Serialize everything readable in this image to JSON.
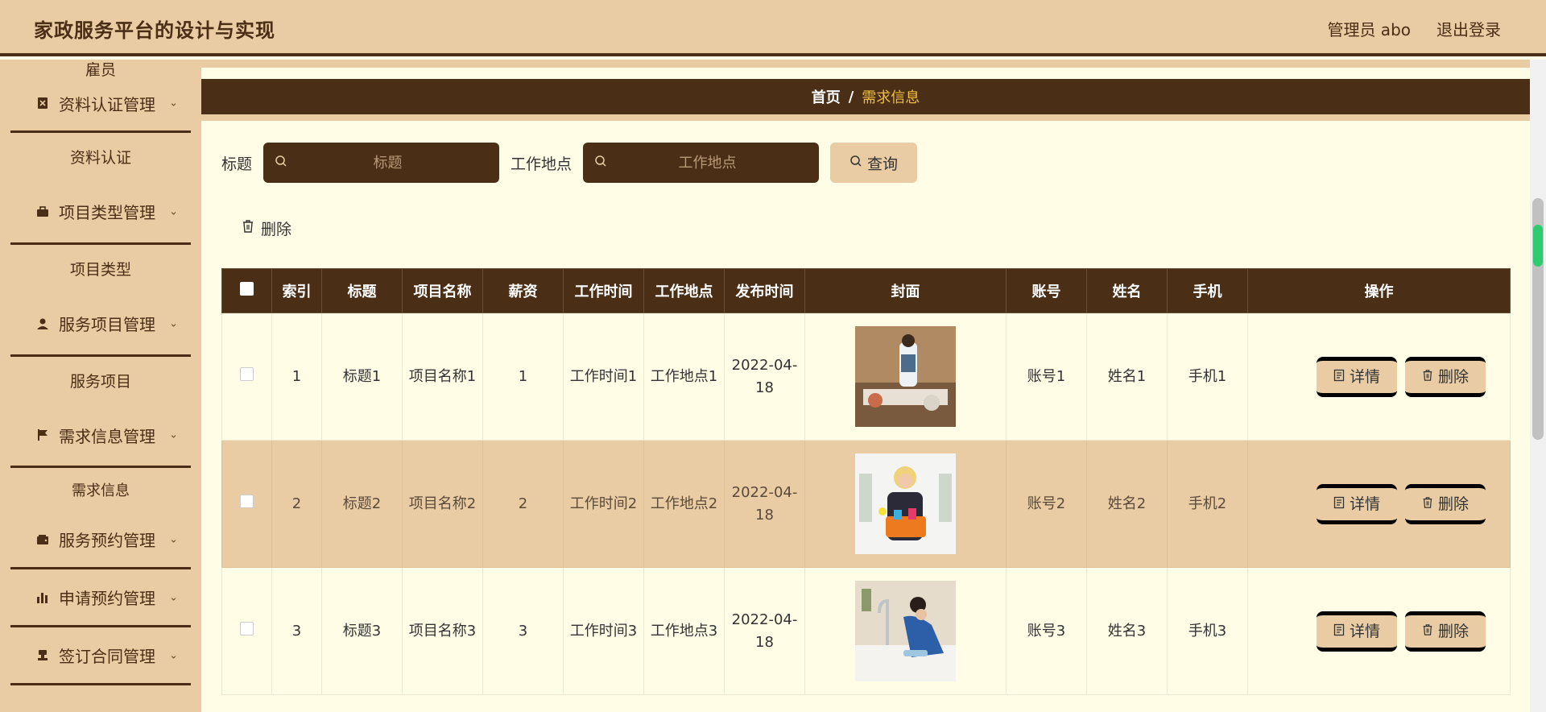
{
  "header": {
    "title": "家政服务平台的设计与实现",
    "user": "管理员 abo",
    "logout": "退出登录"
  },
  "sidebar": {
    "top_sub": "雇员",
    "groups": [
      {
        "label": "资料认证管理",
        "icon": "id-card-icon",
        "sub": "资料认证"
      },
      {
        "label": "项目类型管理",
        "icon": "briefcase-icon",
        "sub": "项目类型"
      },
      {
        "label": "服务项目管理",
        "icon": "person-icon",
        "sub": "服务项目"
      },
      {
        "label": "需求信息管理",
        "icon": "flag-icon",
        "sub": "需求信息"
      },
      {
        "label": "服务预约管理",
        "icon": "wallet-icon"
      },
      {
        "label": "申请预约管理",
        "icon": "bar-chart-icon"
      },
      {
        "label": "签订合同管理",
        "icon": "stamp-icon"
      }
    ]
  },
  "breadcrumb": {
    "home": "首页",
    "sep": "/",
    "current": "需求信息"
  },
  "filter": {
    "title_label": "标题",
    "title_placeholder": "标题",
    "location_label": "工作地点",
    "location_placeholder": "工作地点",
    "query": "查询"
  },
  "actions": {
    "delete": "删除"
  },
  "table": {
    "headers": [
      "索引",
      "标题",
      "项目名称",
      "薪资",
      "工作时间",
      "工作地点",
      "发布时间",
      "封面",
      "账号",
      "姓名",
      "手机",
      "操作"
    ],
    "rows": [
      {
        "index": "1",
        "title": "标题1",
        "project": "项目名称1",
        "salary": "1",
        "time": "工作时间1",
        "location": "工作地点1",
        "published": "2022-04-18",
        "account": "账号1",
        "name": "姓名1",
        "phone": "手机1"
      },
      {
        "index": "2",
        "title": "标题2",
        "project": "项目名称2",
        "salary": "2",
        "time": "工作时间2",
        "location": "工作地点2",
        "published": "2022-04-18",
        "account": "账号2",
        "name": "姓名2",
        "phone": "手机2"
      },
      {
        "index": "3",
        "title": "标题3",
        "project": "项目名称3",
        "salary": "3",
        "time": "工作时间3",
        "location": "工作地点3",
        "published": "2022-04-18",
        "account": "账号3",
        "name": "姓名3",
        "phone": "手机3"
      }
    ],
    "detail_btn": "详情",
    "delete_btn": "删除"
  },
  "colors": {
    "brown": "#4a2e16",
    "tan": "#e9cca3",
    "cream": "#fffde6",
    "accent": "#f0c040"
  }
}
